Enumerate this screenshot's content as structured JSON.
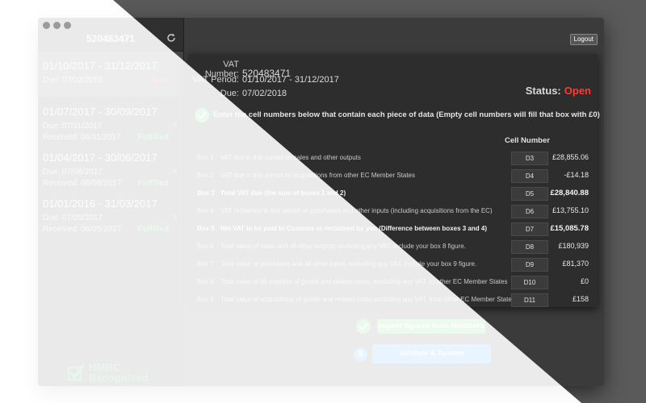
{
  "sidebar": {
    "title": "520483471",
    "periods": [
      {
        "dates": "01/10/2017 - 31/12/2017",
        "due": "Due: 07/02/2018",
        "status": "Open"
      },
      {
        "dates": "01/07/2017 - 30/09/2017",
        "due": "Due: 07/11/2017",
        "received": "Received: 06/11/2017",
        "status": "Fulfilled"
      },
      {
        "dates": "01/04/2017 - 30/06/2017",
        "due": "Due: 07/08/2017",
        "received": "Received: 06/08/2017",
        "status": "Fulfilled"
      },
      {
        "dates": "01/01/2016 - 31/03/2017",
        "due": "Due: 07/05/2017",
        "received": "Received: 06/05/2017",
        "status": "Fulfilled"
      }
    ],
    "badge_line1": "HMRC",
    "badge_line2": "Recognised"
  },
  "toolbar": {
    "logout_label": "Logout"
  },
  "header": {
    "vat_number_label": "VAT Number:",
    "vat_number": "520483471",
    "vat_period_label": "VAT Period:",
    "vat_period": "01/10/2017 - 31/12/2017",
    "due_label": "Due:",
    "due": "07/02/2018",
    "status_label": "Status:",
    "status": "Open"
  },
  "instructions": "Enter the cell numbers below that contain each piece of data (Empty cell numbers will fill that box with £0)",
  "cell_number_header": "Cell Number",
  "boxes": [
    {
      "num": "Box 1",
      "desc": "VAT due in this period on sales and other outputs",
      "cell": "D3",
      "value": "£28,855.06"
    },
    {
      "num": "Box 2",
      "desc": "VAT due in this period on acquisitions from other EC Member States",
      "cell": "D4",
      "value": "-£14.18"
    },
    {
      "num": "Box 3",
      "desc": "Total VAT due (the sum of boxes 1 and 2)",
      "cell": "D5",
      "value": "£28,840.88"
    },
    {
      "num": "Box 4",
      "desc": "VAT reclaimed in this period on purchases and other inputs (including acquisitions from the EC)",
      "cell": "D6",
      "value": "£13,755.10"
    },
    {
      "num": "Box 5",
      "desc": "Net VAT to be paid to Customs or reclaimed by you (Difference between boxes 3 and 4)",
      "cell": "D7",
      "value": "£15,085.78"
    },
    {
      "num": "Box 6",
      "desc": "Total value of sales and all other outputs excluding any VAT. Include your box 8 figure.",
      "cell": "D8",
      "value": "£180,939"
    },
    {
      "num": "Box 7",
      "desc": "Total value of purchases and all other inputs excluding any VAT. Include your box 9 figure.",
      "cell": "D9",
      "value": "£81,370"
    },
    {
      "num": "Box 8",
      "desc": "Total value of all supplies of goods and related costs, excluding any VAT, to other EC Member States",
      "cell": "D10",
      "value": "£0"
    },
    {
      "num": "Box 9",
      "desc": "Total value of acquisitions of goods and related costs excluding any VAT, from other EC Member States",
      "cell": "D11",
      "value": "£158"
    }
  ],
  "actions": {
    "import_label": "Import figures from Numbers",
    "step_number": "5",
    "validate_label": "Validate & Review"
  },
  "colors": {
    "open": "#ff3b30",
    "fulfilled": "#34c759",
    "accent_blue": "#1a8cff",
    "import_green": "#28c840"
  }
}
